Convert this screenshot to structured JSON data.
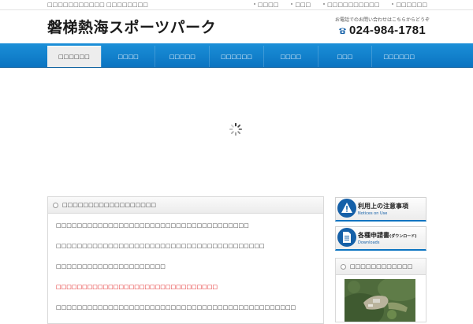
{
  "topbar": {
    "tagline": "□□□□□□□□□□□ □□□□□□□□",
    "links": [
      "□□□□",
      "□□□",
      "□□□□□□□□□□",
      "□□□□□□"
    ]
  },
  "header": {
    "logo": "磐梯熱海スポーツパーク",
    "contact_note": "お電話でのお問い合わせはこちらからどうぞ",
    "phone": "024-984-1781",
    "phone_icon": "telephone-icon"
  },
  "nav": {
    "items": [
      "□□□□□□",
      "□□□□",
      "□□□□□",
      "□□□□□□",
      "□□□□",
      "□□□",
      "□□□□□□"
    ],
    "active_index": 0
  },
  "main": {
    "heading": "□□□□□□□□□□□□□□□□□□",
    "paragraphs": [
      "□□□□□□□□□□□□□□□□□□□□□□□□□□□□□□□□□□□□□",
      "□□□□□□□□□□□□□□□□□□□□□□□□□□□□□□□□□□□□□□□□",
      "□□□□□□□□□□□□□□□□□□□□□",
      "□□□□□□□□□□□□□□□□□□□□□□□□□□□□□□□",
      "□□□□□□□□□□□□□□□□□□□□□□□□□□□□□□□□□□□□□□□□□□□□□□"
    ],
    "highlight_color": "#e00000"
  },
  "sidebar": {
    "notice": {
      "title": "利用上の注意事項",
      "subtitle": "Notices on Use",
      "icon": "warning-icon"
    },
    "downloads": {
      "title": "各種申請書",
      "title_suffix": "(ダウンロード)",
      "subtitle": "Downloads",
      "icon": "document-icon"
    },
    "box_heading": "□□□□□□□□□□□□"
  },
  "colors": {
    "accent": "#0b74c1",
    "nav_active_bg": "#ededed",
    "icon_bg": "#1560a8"
  }
}
